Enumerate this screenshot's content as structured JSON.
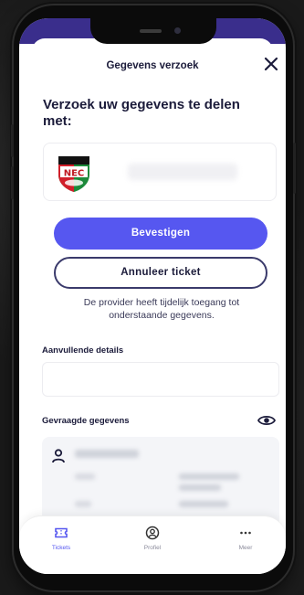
{
  "header": {
    "title": "Gegevens verzoek"
  },
  "request": {
    "heading_line1": "Verzoek uw gegevens te delen",
    "heading_line2": "met:",
    "provider_logo_text": "NEC"
  },
  "actions": {
    "confirm_label": "Bevestigen",
    "cancel_label": "Annuleer ticket"
  },
  "info": {
    "line1": "De provider heeft tijdelijk toegang tot",
    "line2": "onderstaande gegevens."
  },
  "sections": {
    "additional_details": "Aanvullende details",
    "requested_data": "Gevraagde gegevens"
  },
  "nav": {
    "items": [
      {
        "label": "Tickets",
        "icon": "ticket-icon"
      },
      {
        "label": "Profiel",
        "icon": "profile-icon"
      },
      {
        "label": "Meer",
        "icon": "more-icon"
      }
    ]
  },
  "colors": {
    "primary": "#5657f0",
    "text_dark": "#1b1b3a",
    "header_band": "#3a2e8c",
    "logo_red": "#d11f2a",
    "logo_green": "#1c8a3a"
  }
}
